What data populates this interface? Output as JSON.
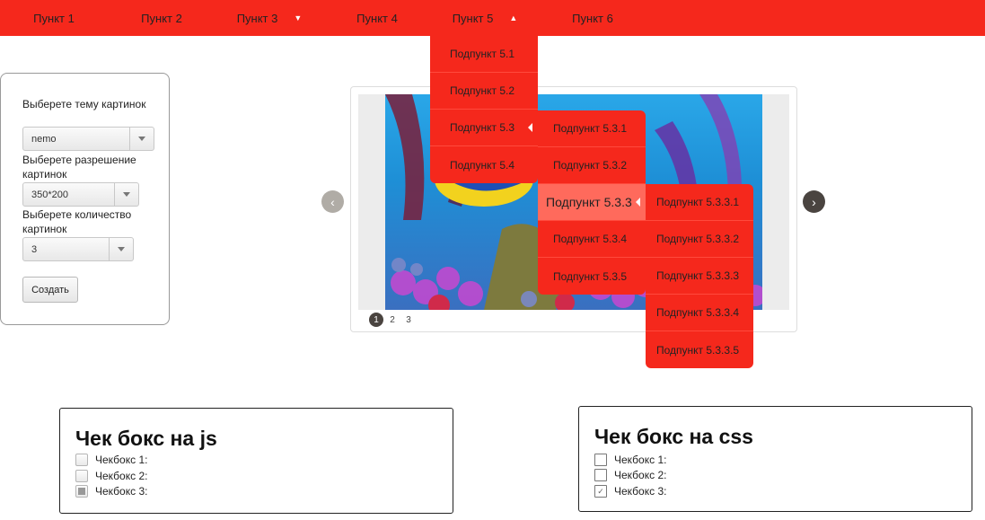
{
  "menu": {
    "items": [
      "Пункт 1",
      "Пункт 2",
      "Пункт 3",
      "Пункт 4",
      "Пункт 5",
      "Пункт 6"
    ],
    "sub5": [
      "Подпункт 5.1",
      "Подпункт 5.2",
      "Подпункт 5.3",
      "Подпункт 5.4"
    ],
    "sub53": [
      "Подпункт 5.3.1",
      "Подпункт 5.3.2",
      "Подпункт 5.3.3",
      "Подпункт 5.3.4",
      "Подпункт 5.3.5"
    ],
    "sub533": [
      "Подпункт 5.3.3.1",
      "Подпункт 5.3.3.2",
      "Подпункт 5.3.3.3",
      "Подпункт 5.3.3.4",
      "Подпункт 5.3.3.5"
    ]
  },
  "form": {
    "theme_label": "Выберете тему картинок",
    "theme_value": "nemo",
    "resolution_label": "Выберете разрешение картинок",
    "resolution_value": "350*200",
    "count_label": "Выберете количество картинок",
    "count_value": "3",
    "create_button": "Создать"
  },
  "carousel": {
    "prev_icon": "‹",
    "next_icon": "›",
    "pages": [
      "1",
      "2",
      "3"
    ],
    "active_page": 1
  },
  "checkbox_js": {
    "title": "Чек бокс на js",
    "items": [
      "Чекбокс 1:",
      "Чекбокс 2:",
      "Чекбокс 3:"
    ],
    "checked": [
      false,
      false,
      true
    ]
  },
  "checkbox_css": {
    "title": "Чек бокс на css",
    "items": [
      "Чекбокс 1:",
      "Чекбокс 2:",
      "Чекбокс 3:"
    ],
    "checked": [
      false,
      false,
      true
    ]
  },
  "colors": {
    "menu": "#f5281c",
    "menu_highlight": "#ff6a5c"
  }
}
